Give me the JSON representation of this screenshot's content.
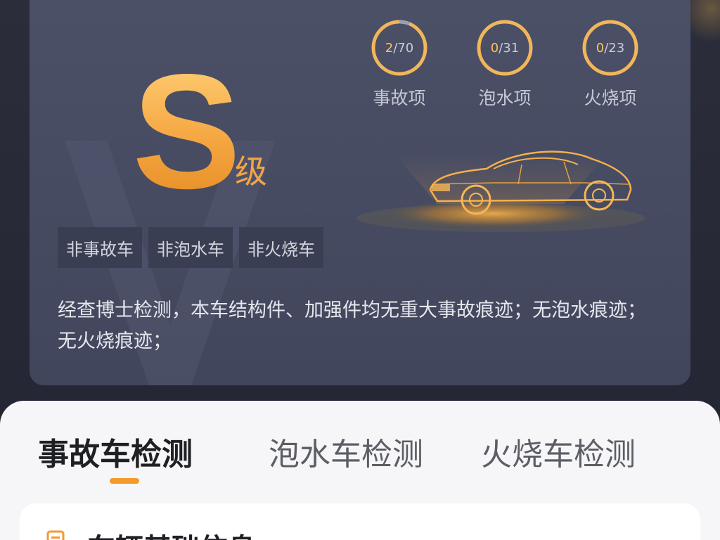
{
  "grade": {
    "letter": "S",
    "suffix": "级"
  },
  "metrics": [
    {
      "value": "2",
      "total": "/70",
      "label": "事故项",
      "fraction": 0.0286
    },
    {
      "value": "0",
      "total": "/31",
      "label": "泡水项",
      "fraction": 0
    },
    {
      "value": "0",
      "total": "/23",
      "label": "火烧项",
      "fraction": 0
    }
  ],
  "badges": [
    "非事故车",
    "非泡水车",
    "非火烧车"
  ],
  "summary": "经查博士检测，本车结构件、加强件均无重大事故痕迹；无泡水痕迹；无火烧痕迹；",
  "tabs": [
    {
      "label": "事故车检测",
      "active": true
    },
    {
      "label": "泡水车检测",
      "active": false
    },
    {
      "label": "火烧车检测",
      "active": false
    }
  ],
  "section": {
    "icon": "document-icon",
    "title": "车辆基础信息"
  },
  "colors": {
    "accent": "#f3a544",
    "ring": "#f2b65a",
    "card_bg": "#464b62",
    "badge_bg": "#3a3e52",
    "sheet_bg": "#f6f6f8",
    "tab_indicator": "#f39a2c"
  }
}
